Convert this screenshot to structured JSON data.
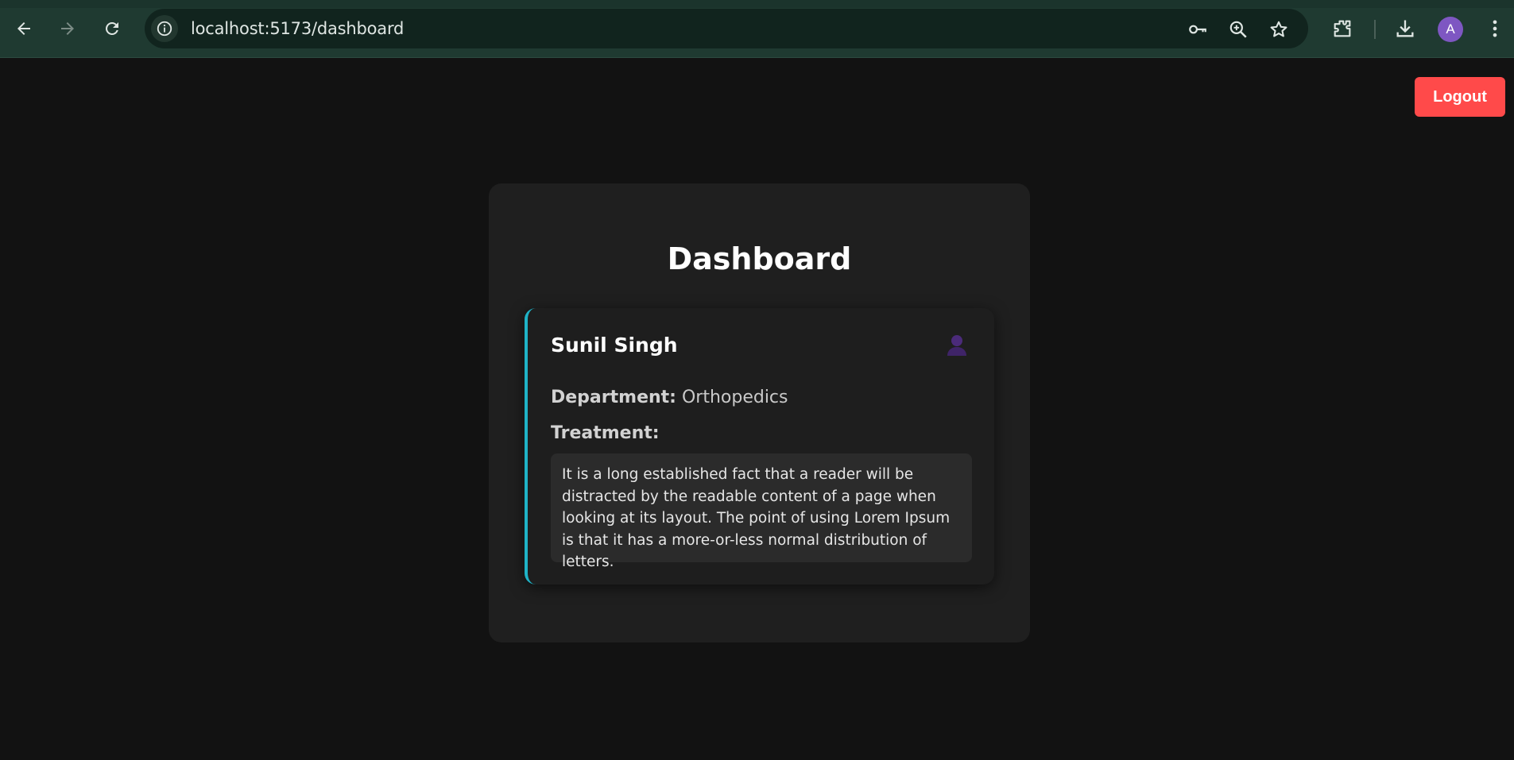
{
  "browser": {
    "url": "localhost:5173/dashboard",
    "profile_initial": "A",
    "icons": [
      "back-arrow-icon",
      "forward-arrow-icon",
      "reload-icon",
      "info-icon",
      "key-icon",
      "zoom-icon",
      "star-icon",
      "extensions-icon",
      "download-icon",
      "more-vert-icon"
    ]
  },
  "page": {
    "logout_label": "Logout",
    "title": "Dashboard",
    "card": {
      "name": "Sunil Singh",
      "department_label": "Department:",
      "department_value": "Orthopedics",
      "treatment_label": "Treatment:",
      "treatment_text": "It is a long established fact that a reader will be distracted by the readable content of a page when looking at its layout. The point of using Lorem Ipsum is that it has a more-or-less normal distribution of letters."
    }
  },
  "colors": {
    "background": "#121212",
    "panel": "#1f1f1f",
    "accent": "#1fb3c7",
    "logout": "#ff4a4a",
    "avatar": "#7e57c2"
  }
}
